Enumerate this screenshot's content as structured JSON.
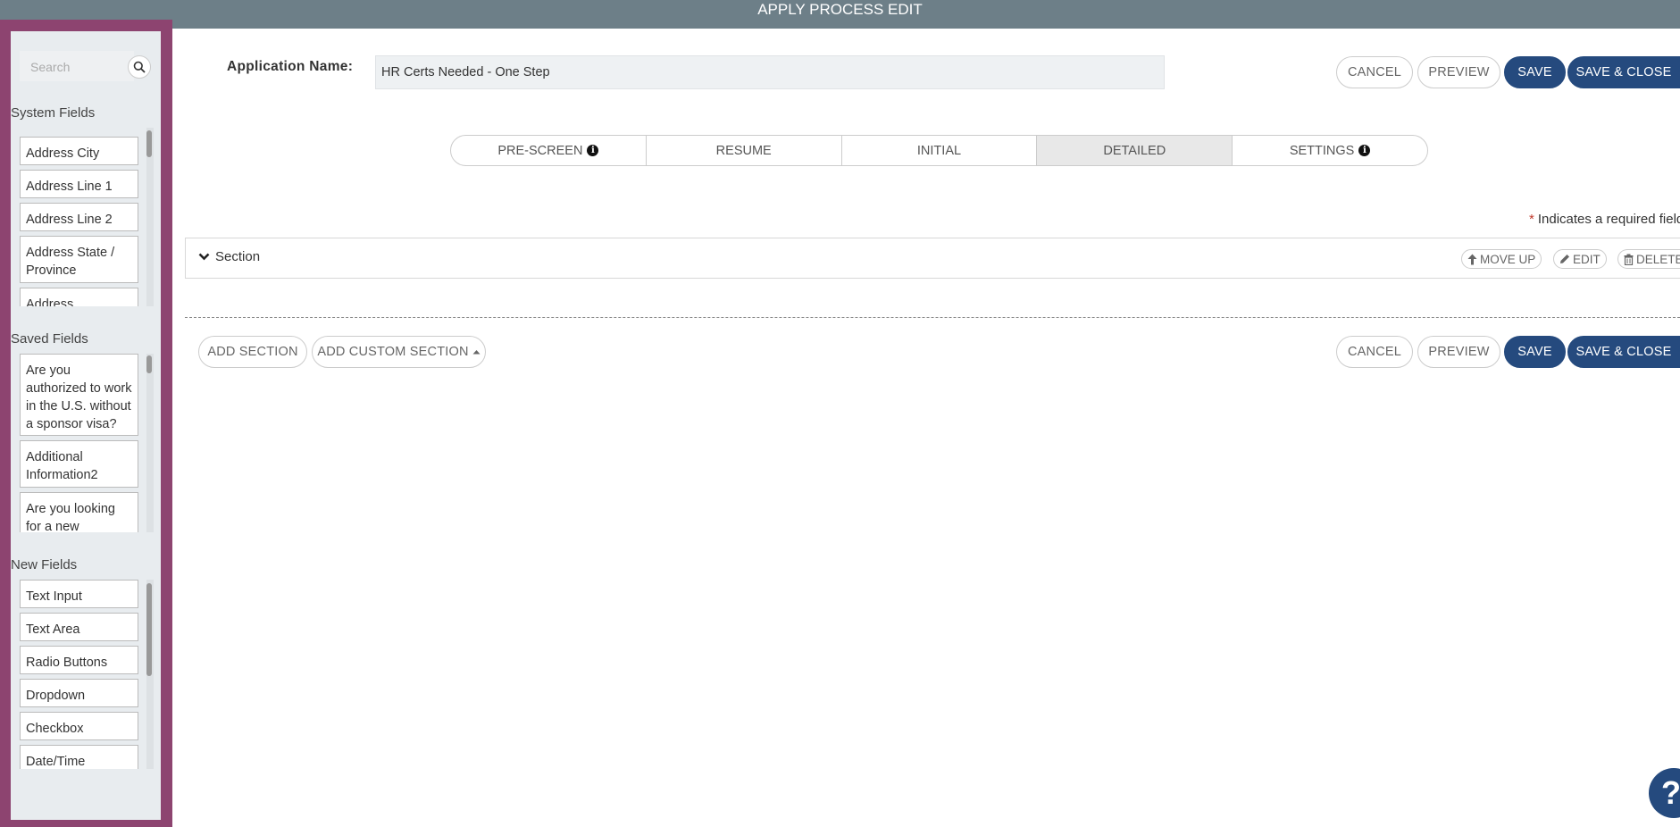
{
  "header": {
    "title": "APPLY PROCESS EDIT"
  },
  "sidebar": {
    "search_placeholder": "Search",
    "system_fields": {
      "title": "System Fields",
      "items": [
        "Address City",
        "Address Line 1",
        "Address Line 2",
        "Address State / Province",
        "Address ZIP/Postal Code"
      ]
    },
    "saved_fields": {
      "title": "Saved Fields",
      "items": [
        "Are you authorized to work in the U.S. without a sponsor visa?",
        "Additional Information2",
        "Are you looking for a new opportunity?"
      ]
    },
    "new_fields": {
      "title": "New Fields",
      "items": [
        "Text Input",
        "Text Area",
        "Radio Buttons",
        "Dropdown",
        "Checkbox",
        "Date/Time"
      ]
    }
  },
  "form": {
    "app_name_label": "Application Name:",
    "app_name_value": "HR Certs Needed - One Step"
  },
  "actions": {
    "cancel": "CANCEL",
    "preview": "PREVIEW",
    "save": "SAVE",
    "save_close": "SAVE & CLOSE"
  },
  "tabs": [
    {
      "label": "PRE-SCREEN",
      "info": true
    },
    {
      "label": "RESUME",
      "info": false
    },
    {
      "label": "INITIAL",
      "info": false
    },
    {
      "label": "DETAILED",
      "info": false,
      "active": true
    },
    {
      "label": "SETTINGS",
      "info": true
    }
  ],
  "required_note": {
    "star": "*",
    "text": "Indicates a required field"
  },
  "section": {
    "label": "Section",
    "move_up": "MOVE UP",
    "edit": "EDIT",
    "delete": "DELETE"
  },
  "bottom": {
    "add_section": "ADD SECTION",
    "add_custom_section": "ADD CUSTOM SECTION"
  },
  "help": {
    "label": "?"
  },
  "colors": {
    "primary": "#254a7e",
    "sidebar_frame": "#8d4470",
    "topbar": "#6d7f88"
  }
}
